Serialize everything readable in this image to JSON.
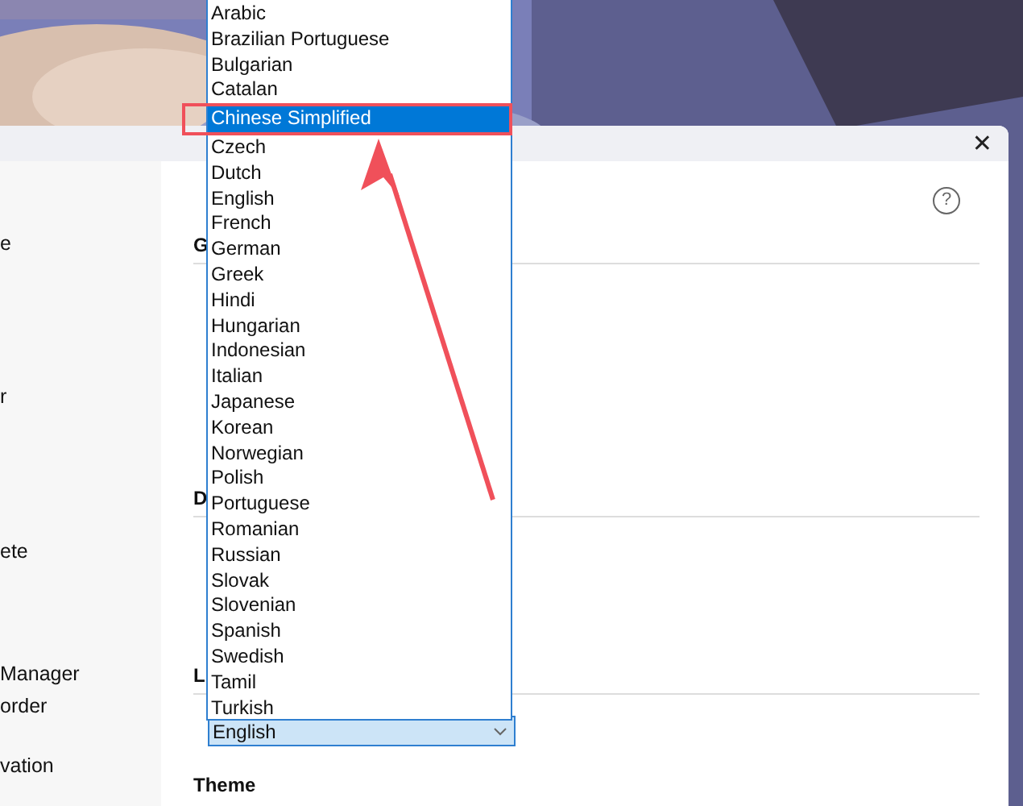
{
  "window": {
    "close": "✕"
  },
  "sidebar": {
    "items": [
      {
        "label": "e"
      },
      {
        "label": "r"
      },
      {
        "label": "ete"
      },
      {
        "label": "Manager"
      },
      {
        "label": "order"
      },
      {
        "label": "vation"
      }
    ]
  },
  "content": {
    "help": "?",
    "sections": [
      {
        "title": "G"
      },
      {
        "title": "D"
      },
      {
        "title": "L"
      }
    ],
    "language_select": {
      "value": "English"
    },
    "theme_title": "Theme"
  },
  "dropdown": {
    "options": [
      {
        "label": "Arabic",
        "selected": false
      },
      {
        "label": "Brazilian Portuguese",
        "selected": false
      },
      {
        "label": "Bulgarian",
        "selected": false
      },
      {
        "label": "Catalan",
        "selected": false
      },
      {
        "label": "Chinese Simplified",
        "selected": true
      },
      {
        "label": "Czech",
        "selected": false
      },
      {
        "label": "Dutch",
        "selected": false
      },
      {
        "label": "English",
        "selected": false
      },
      {
        "label": "French",
        "selected": false
      },
      {
        "label": "German",
        "selected": false
      },
      {
        "label": "Greek",
        "selected": false
      },
      {
        "label": "Hindi",
        "selected": false
      },
      {
        "label": "Hungarian",
        "selected": false
      },
      {
        "label": "Indonesian",
        "selected": false
      },
      {
        "label": "Italian",
        "selected": false
      },
      {
        "label": "Japanese",
        "selected": false
      },
      {
        "label": "Korean",
        "selected": false
      },
      {
        "label": "Norwegian",
        "selected": false
      },
      {
        "label": "Polish",
        "selected": false
      },
      {
        "label": "Portuguese",
        "selected": false
      },
      {
        "label": "Romanian",
        "selected": false
      },
      {
        "label": "Russian",
        "selected": false
      },
      {
        "label": "Slovak",
        "selected": false
      },
      {
        "label": "Slovenian",
        "selected": false
      },
      {
        "label": "Spanish",
        "selected": false
      },
      {
        "label": "Swedish",
        "selected": false
      },
      {
        "label": "Tamil",
        "selected": false
      },
      {
        "label": "Turkish",
        "selected": false
      }
    ]
  }
}
